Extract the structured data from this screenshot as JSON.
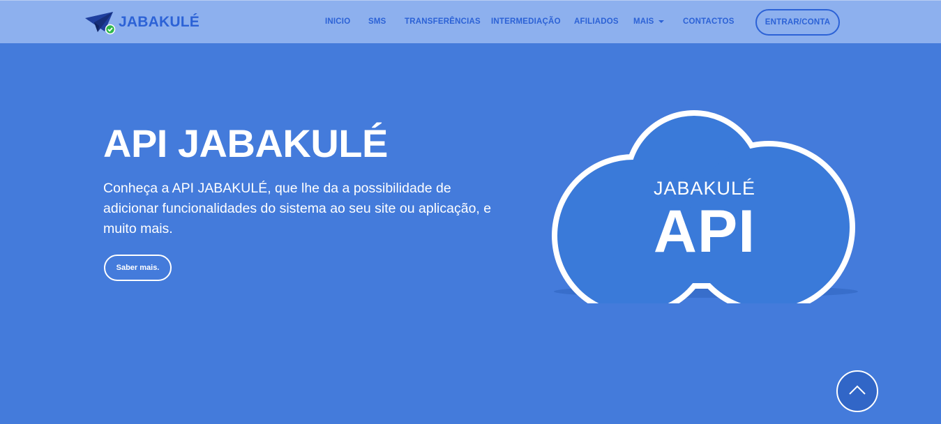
{
  "brand": {
    "name": "JABAKULÉ",
    "logo_icon": "paper-plane-check-icon",
    "color": "#2c62d6"
  },
  "nav": {
    "items": [
      {
        "label": "INICIO"
      },
      {
        "label": "SMS"
      },
      {
        "label": "TRANSFERÊNCIAS"
      },
      {
        "label": "INTERMEDIAÇÃO"
      },
      {
        "label": "AFILIADOS"
      },
      {
        "label": "MAIS",
        "has_dropdown": true
      },
      {
        "label": "CONTACTOS"
      }
    ],
    "login_label": "ENTRAR/CONTA"
  },
  "hero": {
    "title": "API JABAKULÉ",
    "text": "Conheça a API JABAKULÉ, que lhe da a possibilidade de adicionar funcionalidades do sistema ao seu site ou aplicação, e muito mais.",
    "button_label": "Saber mais."
  },
  "cloud_image": {
    "small_text": "JABAKULÉ",
    "big_text": "API",
    "fill_color": "#3a7ad9",
    "outline_color": "#ffffff"
  },
  "scroll_top": {
    "icon": "chevron-up-icon"
  },
  "colors": {
    "background": "#447bdb",
    "navbar": "#8db0ee",
    "accent": "#2c62d6"
  }
}
